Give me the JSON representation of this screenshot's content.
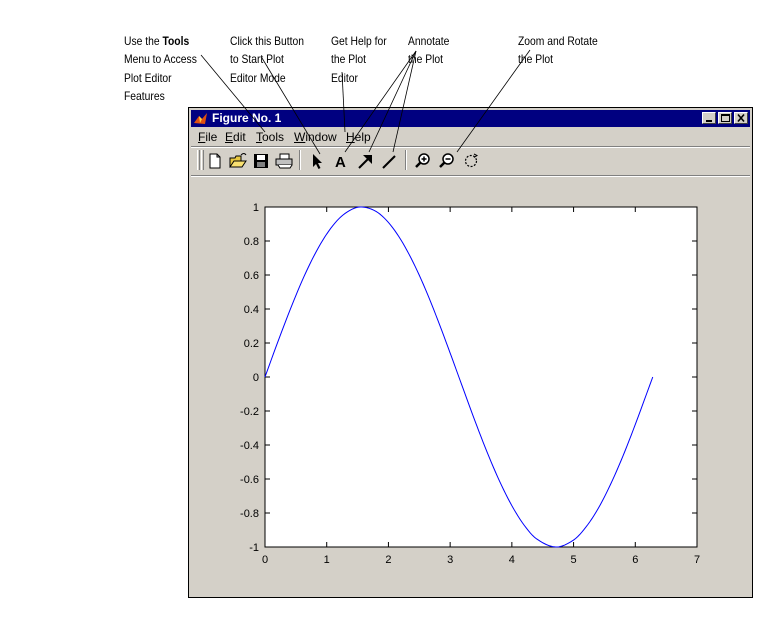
{
  "callouts": [
    {
      "id": "tools",
      "pre": "Use the ",
      "bold": "Tools",
      "post": "\nMenu to Access\nPlot Editor\nFeatures"
    },
    {
      "id": "button",
      "pre": "Click this Button\nto Start Plot\nEditor Mode",
      "bold": "",
      "post": ""
    },
    {
      "id": "help",
      "pre": "Get Help for\nthe Plot\nEditor",
      "bold": "",
      "post": ""
    },
    {
      "id": "annotate",
      "pre": "Annotate\nthe Plot",
      "bold": "",
      "post": ""
    },
    {
      "id": "zoom",
      "pre": "Zoom and Rotate\nthe Plot",
      "bold": "",
      "post": ""
    }
  ],
  "window": {
    "title": "Figure No. 1",
    "menu": [
      "File",
      "Edit",
      "Tools",
      "Window",
      "Help"
    ],
    "toolbar_icons": [
      "new-figure-icon",
      "open-file-icon",
      "save-icon",
      "print-icon",
      "edit-plot-arrow-icon",
      "insert-text-icon",
      "insert-arrow-icon",
      "insert-line-icon",
      "zoom-in-icon",
      "zoom-out-icon",
      "rotate-3d-icon"
    ]
  },
  "chart_data": {
    "type": "line",
    "title": "",
    "xlabel": "",
    "ylabel": "",
    "xlim": [
      0,
      7
    ],
    "ylim": [
      -1,
      1
    ],
    "xticks": [
      0,
      1,
      2,
      3,
      4,
      5,
      6,
      7
    ],
    "yticks": [
      -1,
      -0.8,
      -0.6,
      -0.4,
      -0.2,
      0,
      0.2,
      0.4,
      0.6,
      0.8,
      1
    ],
    "xtick_labels": [
      "0",
      "1",
      "2",
      "3",
      "4",
      "5",
      "6",
      "7"
    ],
    "ytick_labels": [
      "-1",
      "-0.8",
      "-0.6",
      "-0.4",
      "-0.2",
      "0",
      "0.2",
      "0.4",
      "0.6",
      "0.8",
      "1"
    ],
    "grid": false,
    "series": [
      {
        "color": "#0000ff",
        "x": [
          0,
          0.2,
          0.4,
          0.6,
          0.8,
          1.0,
          1.2,
          1.4,
          1.5708,
          1.8,
          2.0,
          2.2,
          2.4,
          2.6,
          2.8,
          3.0,
          3.1416,
          3.4,
          3.6,
          3.8,
          4.0,
          4.2,
          4.4,
          4.7124,
          5.0,
          5.2,
          5.4,
          5.6,
          5.8,
          6.0,
          6.2832
        ],
        "y": [
          0,
          0.199,
          0.389,
          0.565,
          0.717,
          0.841,
          0.932,
          0.985,
          1.0,
          0.974,
          0.909,
          0.808,
          0.675,
          0.516,
          0.335,
          0.141,
          0,
          -0.256,
          -0.443,
          -0.612,
          -0.757,
          -0.872,
          -0.952,
          -1.0,
          -0.959,
          -0.883,
          -0.773,
          -0.631,
          -0.465,
          -0.279,
          0
        ]
      }
    ]
  }
}
